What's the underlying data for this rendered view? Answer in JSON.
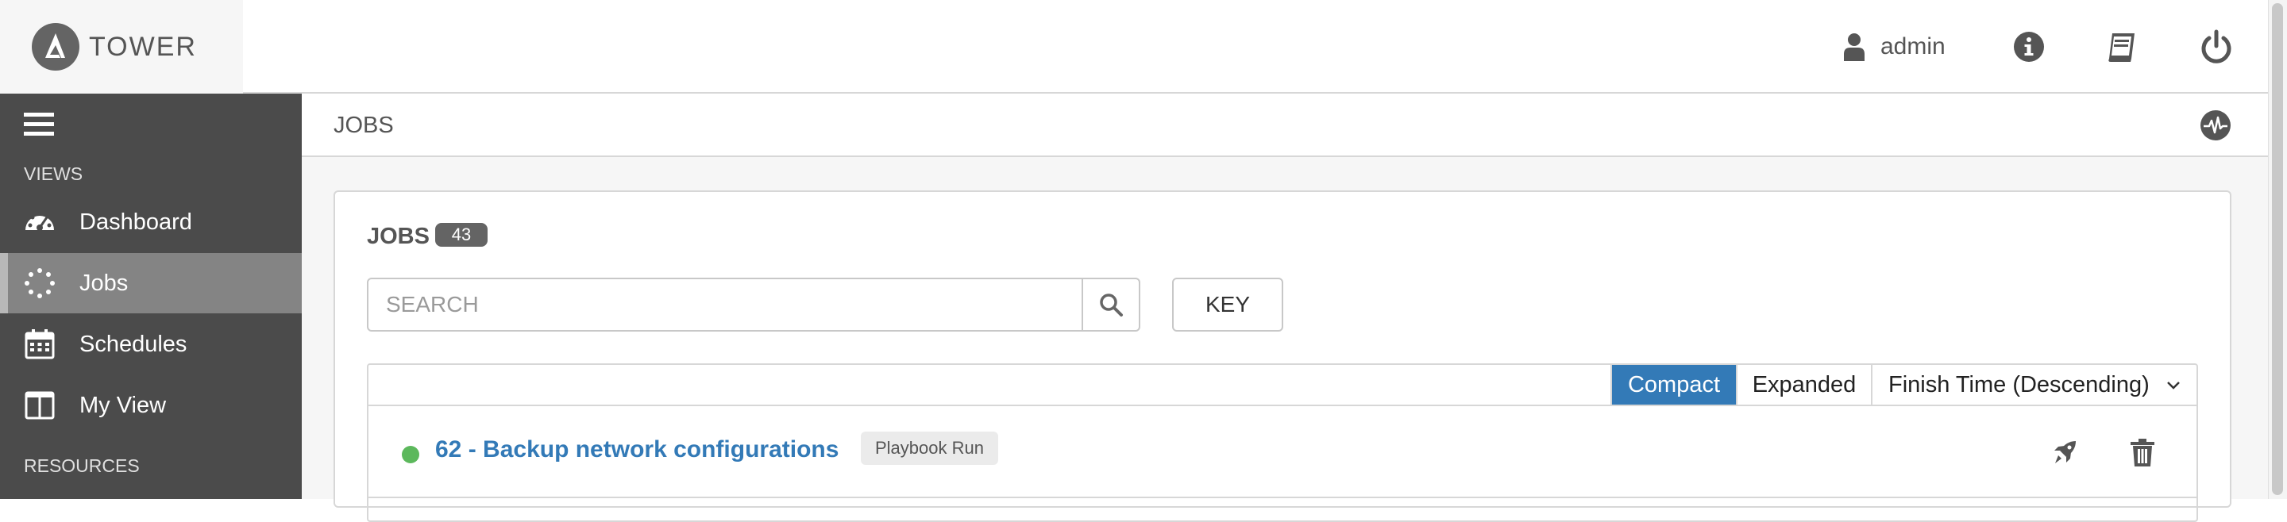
{
  "header": {
    "brand": "TOWER",
    "user": "admin"
  },
  "sidebar": {
    "views_label": "VIEWS",
    "resources_label": "RESOURCES",
    "items": [
      {
        "label": "Dashboard",
        "icon": "dashboard-icon"
      },
      {
        "label": "Jobs",
        "icon": "jobs-spinner-icon",
        "active": true
      },
      {
        "label": "Schedules",
        "icon": "calendar-icon"
      },
      {
        "label": "My View",
        "icon": "columns-icon"
      }
    ]
  },
  "breadcrumb": {
    "current": "JOBS"
  },
  "jobs_panel": {
    "title": "JOBS",
    "count": "43",
    "search_placeholder": "SEARCH",
    "key_label": "KEY",
    "view_compact": "Compact",
    "view_expanded": "Expanded",
    "sort_value": "Finish Time (Descending)"
  },
  "jobs": [
    {
      "name": "62 - Backup network configurations",
      "type": "Playbook Run",
      "status": "successful"
    }
  ],
  "colors": {
    "sidebar_bg": "#4b4b4b",
    "sidebar_active": "#848484",
    "accent": "#337ab7",
    "success": "#5cb85c"
  }
}
